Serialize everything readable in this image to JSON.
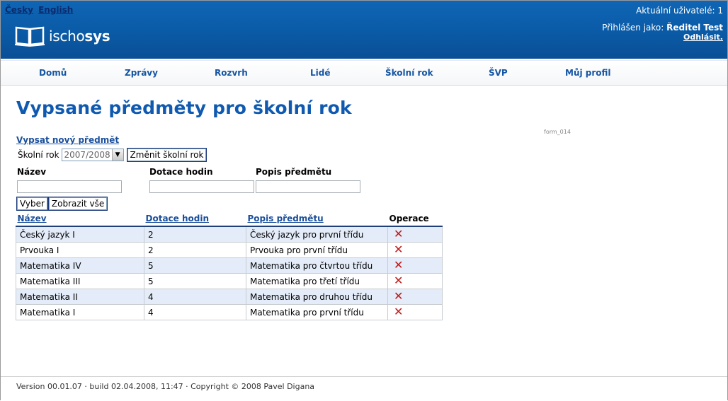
{
  "header": {
    "lang_cs": "Česky",
    "lang_en": "English",
    "logo_text_light": "ischo",
    "logo_text_bold": "sys",
    "current_users": "Aktuální uživatelé: 1",
    "logged_label": "Přihlášen jako:",
    "logged_user": "Ředitel Test",
    "logout": "Odhlásit."
  },
  "nav": [
    "Domů",
    "Zprávy",
    "Rozvrh",
    "Lidé",
    "Školní rok",
    "ŠVP",
    "Můj profil"
  ],
  "page": {
    "title": "Vypsané předměty pro školní rok",
    "form_id": "form_014",
    "new_subject_link": "Vypsat nový předmět",
    "school_year_label": "Školní rok",
    "school_year_value": "2007/2008",
    "change_year_button": "Změnit školní rok"
  },
  "filter": {
    "name_label": "Název",
    "hours_label": "Dotace hodin",
    "desc_label": "Popis předmětu",
    "name_value": "",
    "hours_value": "",
    "desc_value": "",
    "select_button": "Vyber",
    "show_all_button": "Zobrazit vše"
  },
  "table": {
    "headers": [
      "Název",
      "Dotace hodin",
      "Popis předmětu",
      "Operace"
    ],
    "rows": [
      {
        "name": "Český jazyk I",
        "hours": "2",
        "desc": "Český jazyk pro první třídu"
      },
      {
        "name": "Prvouka I",
        "hours": "2",
        "desc": "Prvouka pro první třídu"
      },
      {
        "name": "Matematika IV",
        "hours": "5",
        "desc": "Matematika pro čtvrtou třídu"
      },
      {
        "name": "Matematika III",
        "hours": "5",
        "desc": "Matematika pro třetí třídu"
      },
      {
        "name": "Matematika II",
        "hours": "4",
        "desc": "Matematika pro druhou třídu"
      },
      {
        "name": "Matematika I",
        "hours": "4",
        "desc": "Matematika pro první třídu"
      }
    ],
    "delete_icon": "✕"
  },
  "footer": {
    "text": "Version 00.01.07 · build 02.04.2008, 11:47 · Copyright © 2008 Pavel Digana"
  }
}
